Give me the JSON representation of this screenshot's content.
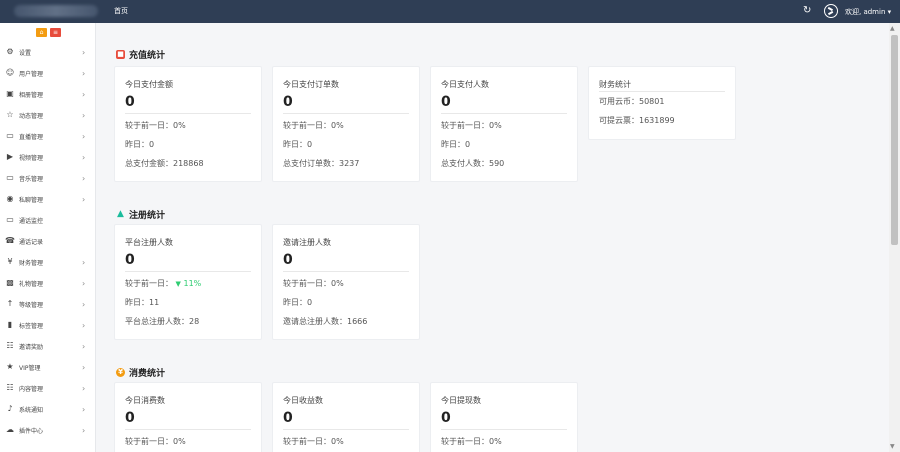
{
  "topbar": {
    "nav_home": "首页",
    "user_text": "欢迎, admin ▾"
  },
  "sidebar": {
    "items": [
      {
        "icon": "gear-icon",
        "label": "设置"
      },
      {
        "icon": "users-icon",
        "label": "用户管理"
      },
      {
        "icon": "image-icon",
        "label": "相册管理"
      },
      {
        "icon": "star-icon",
        "label": "动态管理"
      },
      {
        "icon": "monitor-icon",
        "label": "直播管理"
      },
      {
        "icon": "video-icon",
        "label": "视频管理"
      },
      {
        "icon": "monitor-icon",
        "label": "音乐管理"
      },
      {
        "icon": "message-icon",
        "label": "私聊管理"
      },
      {
        "icon": "monitor-icon",
        "label": "通话监控"
      },
      {
        "icon": "phone-icon",
        "label": "通话记录"
      },
      {
        "icon": "yen-icon",
        "label": "财务管理"
      },
      {
        "icon": "gift-icon",
        "label": "礼物管理"
      },
      {
        "icon": "level-icon",
        "label": "等级管理"
      },
      {
        "icon": "bookmark-icon",
        "label": "标签管理"
      },
      {
        "icon": "sitemap-icon",
        "label": "邀请奖励"
      },
      {
        "icon": "star-icon",
        "label": "VIP管理"
      },
      {
        "icon": "grid-icon",
        "label": "内容管理"
      },
      {
        "icon": "bell-icon",
        "label": "系统通知"
      },
      {
        "icon": "cloud-icon",
        "label": "插件中心"
      }
    ]
  },
  "sections": {
    "recharge": {
      "title": "充值统计",
      "cards": [
        {
          "title": "今日支付金额",
          "value": "0",
          "compare": "较于前一日：0%",
          "yesterday": "昨日：0",
          "total": "总支付金额：218868"
        },
        {
          "title": "今日支付订单数",
          "value": "0",
          "compare": "较于前一日：0%",
          "yesterday": "昨日：0",
          "total": "总支付订单数：3237"
        },
        {
          "title": "今日支付人数",
          "value": "0",
          "compare": "较于前一日：0%",
          "yesterday": "昨日：0",
          "total": "总支付人数：590"
        }
      ],
      "finance": {
        "title": "财务统计",
        "coins": "可用云币：50801",
        "withdrawable": "可提云票：1631899"
      }
    },
    "register": {
      "title": "注册统计",
      "cards": [
        {
          "title": "平台注册人数",
          "value": "0",
          "compare_label": "较于前一日：",
          "compare_value": "11%",
          "yesterday": "昨日：11",
          "total": "平台总注册人数：28"
        },
        {
          "title": "邀请注册人数",
          "value": "0",
          "compare": "较于前一日：0%",
          "yesterday": "昨日：0",
          "total": "邀请总注册人数：1666"
        }
      ]
    },
    "consume": {
      "title": "消费统计",
      "cards": [
        {
          "title": "今日消费数",
          "value": "0",
          "compare": "较于前一日：0%"
        },
        {
          "title": "今日收益数",
          "value": "0",
          "compare": "较于前一日：0%"
        },
        {
          "title": "今日提现数",
          "value": "0",
          "compare": "较于前一日：0%"
        }
      ]
    }
  },
  "colors": {
    "topbar": "#2f3e55",
    "accent_red": "#e74c3c",
    "accent_orange": "#f39c12",
    "accent_teal": "#1abc9c",
    "positive": "#2ecc71"
  }
}
